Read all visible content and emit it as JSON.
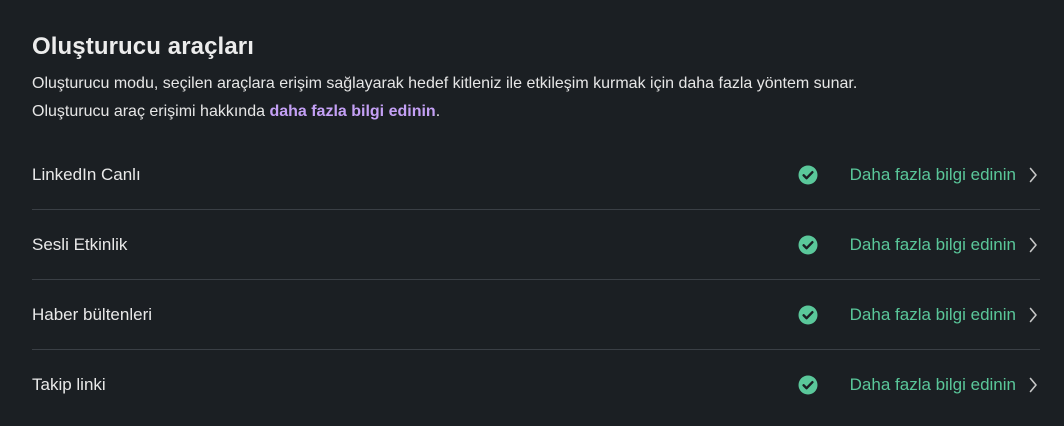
{
  "section": {
    "title": "Oluşturucu araçları",
    "description_line1": "Oluşturucu modu, seçilen araçlara erişim sağlayarak hedef kitleniz ile etkileşim kurmak için daha fazla yöntem sunar.",
    "description_line2_prefix": "Oluşturucu araç erişimi hakkında ",
    "description_link": "daha fazla bilgi edinin",
    "description_line2_suffix": "."
  },
  "tools": [
    {
      "label": "LinkedIn Canlı",
      "status_icon": "check-circle-icon",
      "link": "Daha fazla bilgi edinin"
    },
    {
      "label": "Sesli Etkinlik",
      "status_icon": "check-circle-icon",
      "link": "Daha fazla bilgi edinin"
    },
    {
      "label": "Haber bültenleri",
      "status_icon": "check-circle-icon",
      "link": "Daha fazla bilgi edinin"
    },
    {
      "label": "Takip linki",
      "status_icon": "check-circle-icon",
      "link": "Daha fazla bilgi edinin"
    }
  ],
  "colors": {
    "background": "#1b1f23",
    "link_purple": "#c4a0f5",
    "success_green": "#5ac79a",
    "divider": "#3a3f45"
  }
}
